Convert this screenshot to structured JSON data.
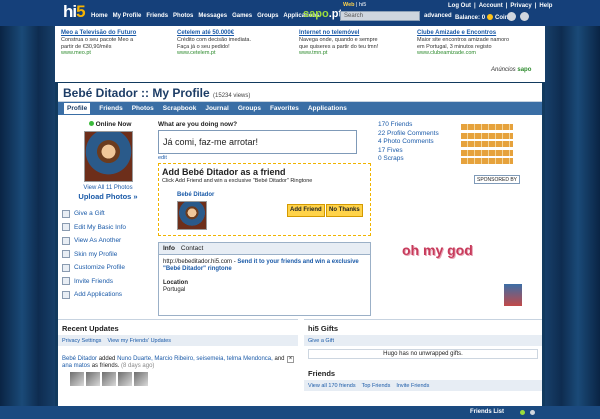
{
  "topbar": {
    "logo": "hi5",
    "nav": [
      "Home",
      "My Profile",
      "Friends",
      "Photos",
      "Messages",
      "Games",
      "Groups",
      "Applications"
    ],
    "sapo_brand": "sapo",
    "sapo_suffix": ".pt",
    "web_label": "Web",
    "hi5_label": "hi5",
    "search_placeholder": "Search",
    "advanced": "advanced",
    "links": [
      "Log Out",
      "Account",
      "Privacy",
      "Help"
    ],
    "balance_label": "Balance:",
    "balance_value": "0",
    "coins_label": "Coins"
  },
  "ads": [
    {
      "title": "Meo a Televisão do Futuro",
      "body": "Construa o seu pacote Meo a partir de €30,90/mês",
      "url": "www.meo.pt"
    },
    {
      "title": "Cetelem até 50.000€",
      "body": "Crédito com decisão imediata. Faça já o seu pedido!",
      "url": "www.cetelem.pt"
    },
    {
      "title": "Internet no telemóvel",
      "body": "Navega onde, quando e sempre que quiseres a partir do teu tmn!",
      "url": "www.tmn.pt"
    },
    {
      "title": "Clube Amizade e Encontros",
      "body": "Maior site encontros amizade namoro em Portugal, 3 minutos registo",
      "url": "www.clubeamizade.com"
    }
  ],
  "ads_footer": {
    "label": "Anúncios",
    "brand": "sapo"
  },
  "profile": {
    "title": "Bebé Ditador :: My Profile",
    "views": "(15234 views)",
    "tabs": [
      "Profile",
      "Friends",
      "Photos",
      "Scrapbook",
      "Journal",
      "Groups",
      "Favorites",
      "Applications"
    ]
  },
  "left": {
    "online": "Online Now",
    "view_all": "View All 11 Photos",
    "upload": "Upload Photos »",
    "menu": [
      "Give a Gift",
      "Edit My Basic Info",
      "View As Another",
      "Skin my Profile",
      "Customize Profile",
      "Invite Friends",
      "Add Applications"
    ]
  },
  "status": {
    "question": "What are you doing now?",
    "value": "Já comi, faz-me arrotar!",
    "edit": "edit"
  },
  "add_friend": {
    "heading": "Add Bebé Ditador as a friend",
    "sub": "Click Add Friend and win a exclusive \"Bebé Ditador\" Ringtone",
    "name": "Bebé Ditador",
    "add_button": "Add Friend",
    "no_button": "No Thanks"
  },
  "info": {
    "tabs": [
      "Info",
      "Contact"
    ],
    "url": "http://bebeditador.hi5.com",
    "send": "Send it to your friends and win a exclusive \"Bebé Ditador\" ringtone",
    "location_label": "Location",
    "location": "Portugal"
  },
  "stats": [
    "170 Friends",
    "22 Profile Comments",
    "4 Photo Comments",
    "17 Fives",
    "0 Scraps"
  ],
  "sponsored": "SPONSORED BY",
  "omg": "oh my god",
  "updates": {
    "heading": "Recent Updates",
    "tabs": [
      "Privacy Settings",
      "View my Friends' Updates"
    ],
    "text_a": "Bebé Ditador",
    "text_b": " added ",
    "text_c": "Nuno Duarte, Marcio Ribeiro, seisemeia, telma Mendonca,",
    "text_d": " and ",
    "text_e": "ana matos",
    "text_f": " as friends. ",
    "ago": "(8 days ago)"
  },
  "gifts": {
    "heading": "hi5 Gifts",
    "give": "Give a Gift",
    "none": "Hugo has no unwrapped gifts."
  },
  "friends": {
    "heading": "Friends",
    "links": [
      "View all 170 friends",
      "Top Friends",
      "Invite Friends"
    ]
  },
  "footer": {
    "friends_list": "Friends List"
  }
}
